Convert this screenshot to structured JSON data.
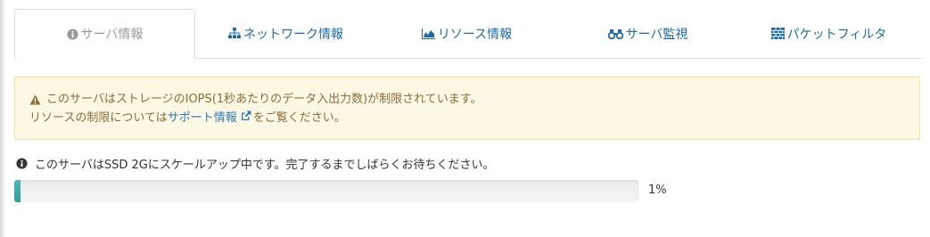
{
  "tabs": [
    {
      "label": "サーバ情報",
      "icon": "info-circle-icon",
      "active": true
    },
    {
      "label": "ネットワーク情報",
      "icon": "sitemap-icon",
      "active": false
    },
    {
      "label": "リソース情報",
      "icon": "area-chart-icon",
      "active": false
    },
    {
      "label": "サーバ監視",
      "icon": "binoculars-icon",
      "active": false
    },
    {
      "label": "パケットフィルタ",
      "icon": "firewall-icon",
      "active": false
    }
  ],
  "alert": {
    "line1": "このサーバはストレージのIOPS(1秒あたりのデータ入出力数)が制限されています。",
    "line2_prefix": "リソースの制限については",
    "line2_link": "サポート情報",
    "line2_suffix": "をご覧ください。",
    "icon": "warning-icon",
    "link_icon": "external-link-icon"
  },
  "status": {
    "message": "このサーバはSSD 2Gにスケールアップ中です。完了するまでしばらくお待ちください。",
    "icon": "info-circle-icon",
    "progress_percent": 1,
    "progress_label": "1%"
  },
  "colors": {
    "tab_link": "#1d6ba5",
    "tab_active": "#999999",
    "alert_bg": "#fcf8e3",
    "alert_text": "#8a6d3b",
    "progress_fill": "#2f9d9d"
  }
}
